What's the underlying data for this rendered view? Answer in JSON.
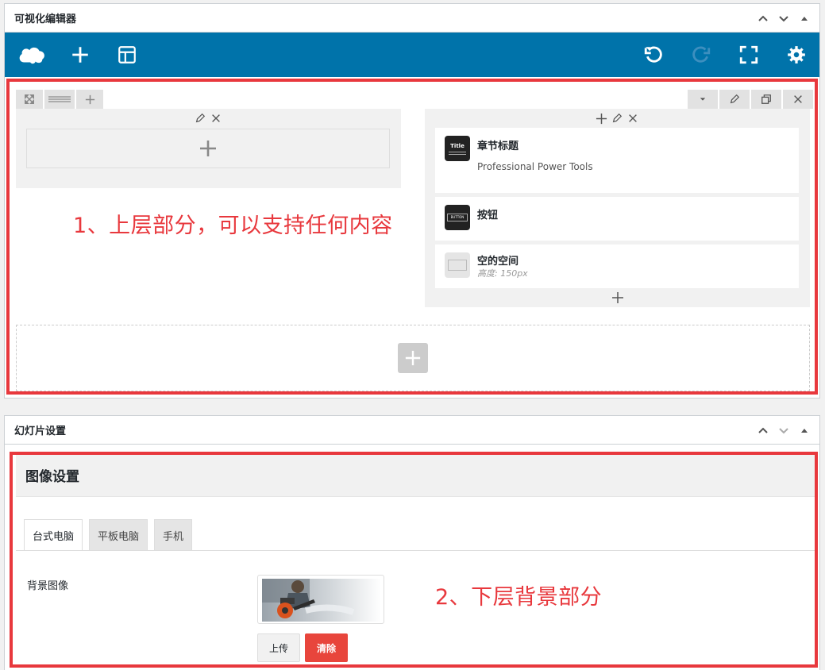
{
  "panel1": {
    "title": "可视化编辑器",
    "controls": [
      "chevron-up-icon",
      "chevron-down-icon",
      "triangle-up-icon"
    ]
  },
  "toolbar": {
    "colors": {
      "background": "#0073aa",
      "icon": "#ffffff",
      "disabled_icon": "#3d8fbf"
    },
    "left_buttons": [
      "logo-cloud-icon",
      "add-icon",
      "layout-icon"
    ],
    "right_buttons": [
      "undo-icon",
      "redo-icon",
      "fullscreen-icon",
      "settings-icon"
    ]
  },
  "builder": {
    "row_tools_left": [
      "move-icon",
      "columns-icon",
      "plus-icon"
    ],
    "row_tools_right": [
      "dropdown-caret-icon",
      "pencil-icon",
      "duplicate-icon",
      "close-icon"
    ],
    "widgets": [
      {
        "name": "章节标题",
        "sub": "Professional Power Tools",
        "icon_text": "Title"
      },
      {
        "name": "按钮",
        "sub": "",
        "icon_text": "BUTTON"
      },
      {
        "name": "空的空间",
        "sub": "高度: 150px",
        "icon_text": ""
      }
    ],
    "annotation": "1、上层部分，可以支持任何内容"
  },
  "panel2": {
    "title": "幻灯片设置",
    "controls": [
      "chevron-up-icon",
      "chevron-down-icon",
      "triangle-up-icon"
    ],
    "section_title": "图像设置",
    "tabs": [
      "台式电脑",
      "平板电脑",
      "手机"
    ],
    "active_tab": "台式电脑",
    "field_label": "背景图像",
    "upload_label": "上传",
    "clear_label": "清除",
    "annotation": "2、下层背景部分"
  },
  "accent_red": "#e8383d"
}
